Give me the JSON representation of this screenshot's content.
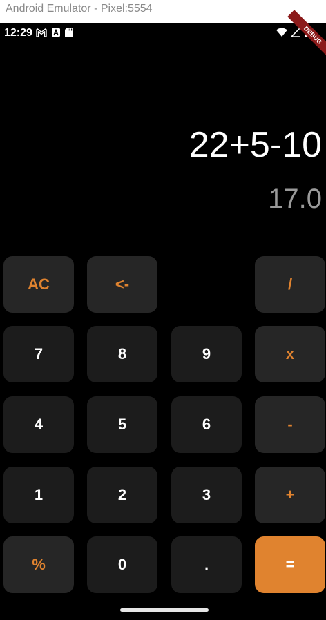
{
  "window": {
    "title": "Android Emulator - Pixel:5554"
  },
  "status_bar": {
    "time": "12:29",
    "icons_left": [
      "gmail-icon",
      "notification-a-icon",
      "sd-card-icon"
    ],
    "icons_right": [
      "wifi-icon",
      "cell-signal-icon",
      "battery-icon"
    ]
  },
  "debug_banner": "DEBUG",
  "display": {
    "expression": "22+5-10",
    "result": "17.0"
  },
  "keys": {
    "ac": "AC",
    "backspace": "<-",
    "divide": "/",
    "seven": "7",
    "eight": "8",
    "nine": "9",
    "multiply": "x",
    "four": "4",
    "five": "5",
    "six": "6",
    "minus": "-",
    "one": "1",
    "two": "2",
    "three": "3",
    "plus": "+",
    "percent": "%",
    "zero": "0",
    "dot": ".",
    "equals": "="
  },
  "colors": {
    "background": "#000000",
    "key": "#1c1c1c",
    "operator_key": "#262626",
    "accent": "#e0832f",
    "result_text": "#9a9a9a"
  }
}
